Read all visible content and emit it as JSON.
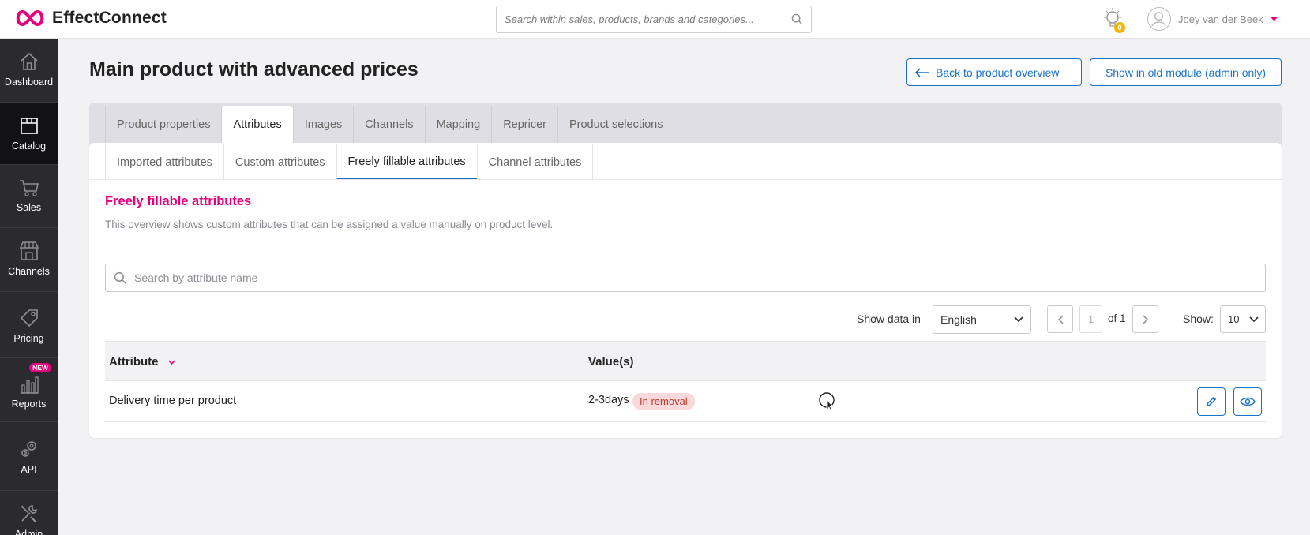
{
  "app": {
    "brand": "EffectConnect",
    "search_placeholder": "Search within sales, products, brands and categories...",
    "notifications_count": "0",
    "user_name": "Joey van der Beek"
  },
  "sidebar": {
    "items": [
      {
        "label": "Dashboard",
        "icon": "house-icon"
      },
      {
        "label": "Catalog",
        "icon": "box-icon"
      },
      {
        "label": "Sales",
        "icon": "cart-icon"
      },
      {
        "label": "Channels",
        "icon": "store-icon"
      },
      {
        "label": "Pricing",
        "icon": "tag-icon"
      },
      {
        "label": "Reports",
        "icon": "bar-chart-icon",
        "badge": "NEW"
      },
      {
        "label": "API",
        "icon": "gears-icon"
      },
      {
        "label": "Admin",
        "icon": "tools-icon"
      }
    ],
    "active": "Catalog"
  },
  "page": {
    "title": "Main product with advanced prices",
    "back_button": "Back to product overview",
    "old_module_button": "Show in old module (admin only)"
  },
  "main_tabs": [
    "Product properties",
    "Attributes",
    "Images",
    "Channels",
    "Mapping",
    "Repricer",
    "Product selections"
  ],
  "main_tab_active": "Attributes",
  "sub_tabs": [
    "Imported attributes",
    "Custom attributes",
    "Freely fillable attributes",
    "Channel attributes"
  ],
  "sub_tab_active": "Freely fillable attributes",
  "section": {
    "title": "Freely fillable attributes",
    "description": "This overview shows custom attributes that can be assigned a value manually on product level.",
    "search_placeholder": "Search by attribute name"
  },
  "controls": {
    "show_data_in_label": "Show data in",
    "language": "English",
    "page_current": "1",
    "page_of": "of 1",
    "show_label": "Show:",
    "show_value": "10"
  },
  "table": {
    "headers": [
      "Attribute",
      "Value(s)"
    ],
    "rows": [
      {
        "attribute": "Delivery time per product",
        "value": "2-3days",
        "status": "In removal"
      }
    ]
  },
  "colors": {
    "brand_pink": "#e6007e",
    "link_blue": "#1a73c8",
    "sidebar_bg": "#2b2b2f",
    "badge_red_bg": "#f9d9dc"
  }
}
